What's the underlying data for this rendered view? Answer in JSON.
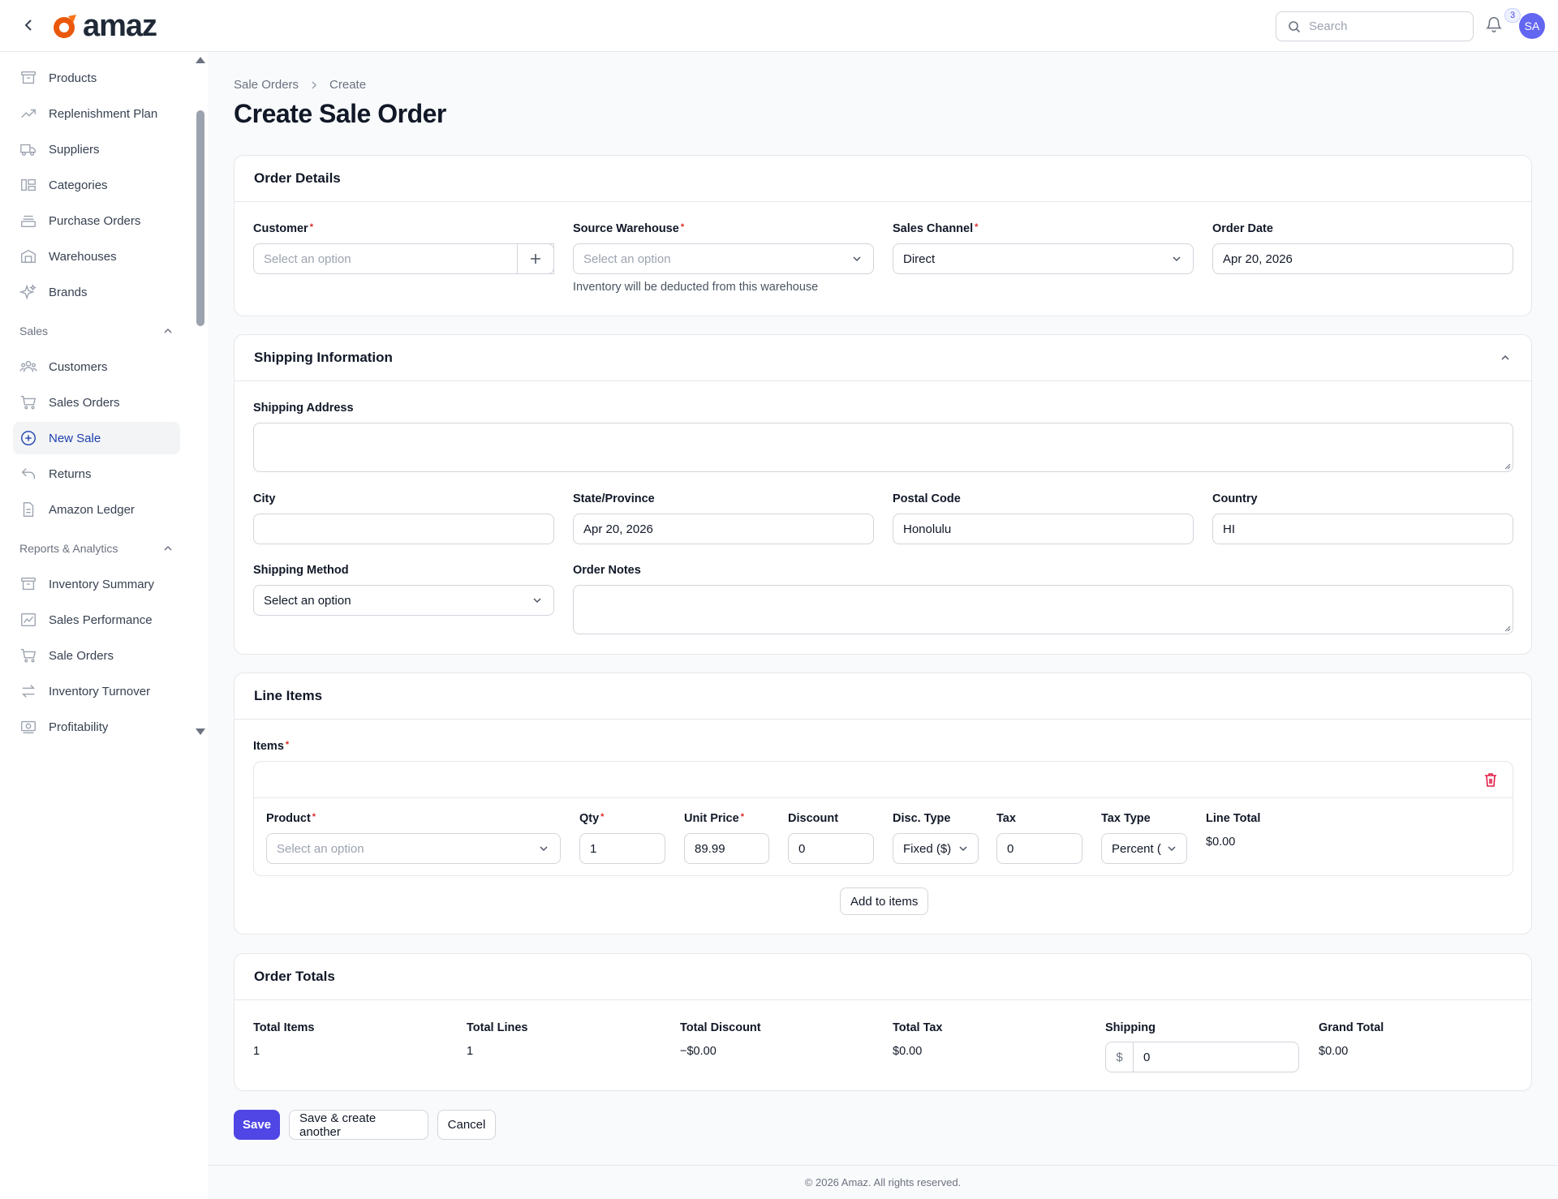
{
  "app": {
    "brand": "amaz"
  },
  "header": {
    "search_placeholder": "Search",
    "notification_count": "3",
    "avatar_initials": "SA"
  },
  "sidebar": {
    "items_top": [
      {
        "label": "Products",
        "icon": "archive-icon"
      },
      {
        "label": "Replenishment Plan",
        "icon": "trend-up-icon"
      },
      {
        "label": "Suppliers",
        "icon": "truck-icon"
      },
      {
        "label": "Categories",
        "icon": "shapes-icon"
      },
      {
        "label": "Purchase Orders",
        "icon": "stack-icon"
      },
      {
        "label": "Warehouses",
        "icon": "building-icon"
      },
      {
        "label": "Brands",
        "icon": "sparkles-icon"
      }
    ],
    "group_sales": "Sales",
    "items_sales": [
      {
        "label": "Customers",
        "icon": "users-icon"
      },
      {
        "label": "Sales Orders",
        "icon": "cart-icon"
      },
      {
        "label": "New Sale",
        "icon": "plus-circle-icon",
        "active": true
      },
      {
        "label": "Returns",
        "icon": "return-icon"
      },
      {
        "label": "Amazon Ledger",
        "icon": "document-icon"
      }
    ],
    "group_reports": "Reports & Analytics",
    "items_reports": [
      {
        "label": "Inventory Summary",
        "icon": "archive-icon"
      },
      {
        "label": "Sales Performance",
        "icon": "chart-icon"
      },
      {
        "label": "Sale Orders",
        "icon": "cart-icon"
      },
      {
        "label": "Inventory Turnover",
        "icon": "arrows-icon"
      },
      {
        "label": "Profitability",
        "icon": "cash-icon"
      }
    ]
  },
  "breadcrumb": {
    "parent": "Sale Orders",
    "current": "Create"
  },
  "page_title": "Create Sale Order",
  "order_details": {
    "title": "Order Details",
    "customer_label": "Customer",
    "customer_placeholder": "Select an option",
    "warehouse_label": "Source Warehouse",
    "warehouse_placeholder": "Select an option",
    "warehouse_hint": "Inventory will be deducted from this warehouse",
    "channel_label": "Sales Channel",
    "channel_value": "Direct",
    "date_label": "Order Date",
    "date_value": "Apr 20, 2026"
  },
  "shipping": {
    "title": "Shipping Information",
    "address_label": "Shipping Address",
    "city_label": "City",
    "city_value": "",
    "state_label": "State/Province",
    "state_value": "Apr 20, 2026",
    "postal_label": "Postal Code",
    "postal_value": "Honolulu",
    "country_label": "Country",
    "country_value": "HI",
    "method_label": "Shipping Method",
    "method_value": "Select an option",
    "notes_label": "Order Notes"
  },
  "line_items": {
    "title": "Line Items",
    "items_label": "Items",
    "product_label": "Product",
    "product_placeholder": "Select an option",
    "qty_label": "Qty",
    "qty_value": "1",
    "unit_price_label": "Unit Price",
    "unit_price_value": "89.99",
    "discount_label": "Discount",
    "discount_value": "0",
    "disc_type_label": "Disc. Type",
    "disc_type_value": "Fixed ($)",
    "tax_label": "Tax",
    "tax_value": "0",
    "tax_type_label": "Tax Type",
    "tax_type_value": "Percent (",
    "line_total_label": "Line Total",
    "line_total_value": "$0.00",
    "add_button": "Add to items"
  },
  "totals": {
    "title": "Order Totals",
    "total_items_label": "Total Items",
    "total_items_value": "1",
    "total_lines_label": "Total Lines",
    "total_lines_value": "1",
    "total_discount_label": "Total Discount",
    "total_discount_value": "−$0.00",
    "total_tax_label": "Total Tax",
    "total_tax_value": "$0.00",
    "shipping_label": "Shipping",
    "shipping_prefix": "$",
    "shipping_value": "0",
    "grand_total_label": "Grand Total",
    "grand_total_value": "$0.00"
  },
  "actions": {
    "save": "Save",
    "save_another": "Save & create another",
    "cancel": "Cancel"
  },
  "footer": "© 2026 Amaz. All rights reserved.",
  "colors": {
    "primary": "#4f46e5",
    "active_nav": "#1e40af",
    "required": "#dc2626",
    "danger": "#e11d48"
  }
}
